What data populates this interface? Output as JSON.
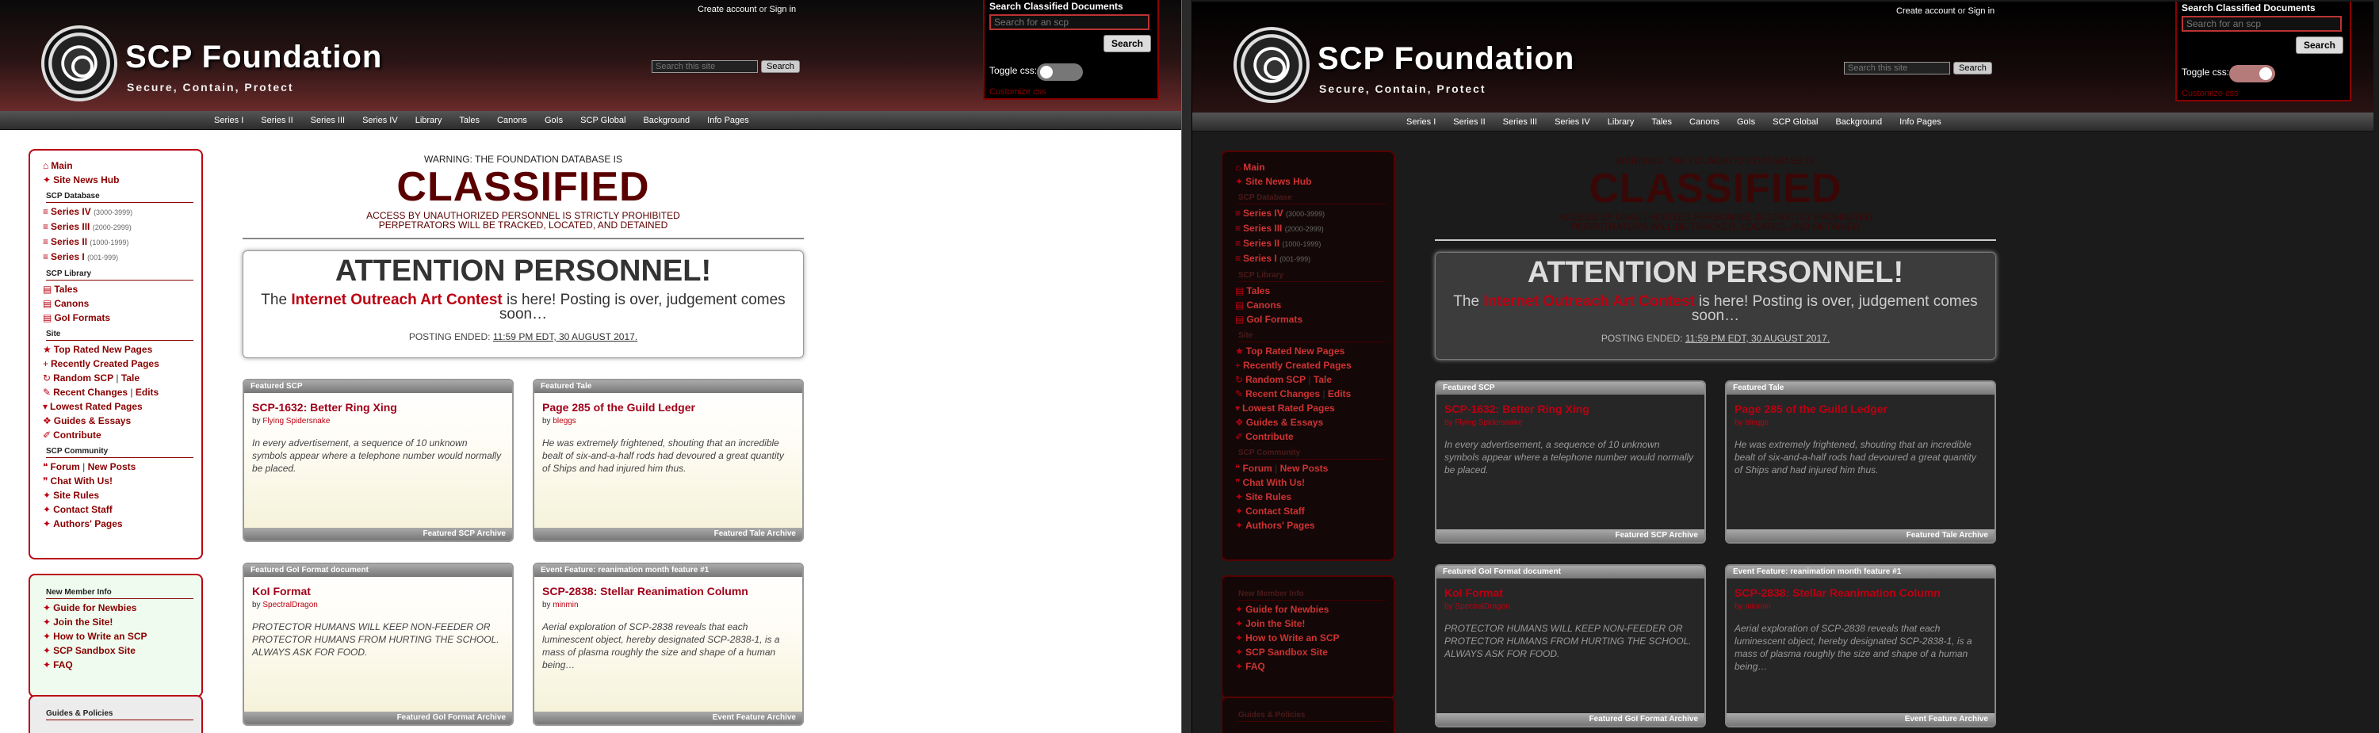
{
  "header": {
    "site_title": "SCP Foundation",
    "tagline": "Secure, Contain, Protect",
    "account_create": "Create account",
    "account_or": "or",
    "account_signin": "Sign in",
    "site_search_placeholder": "Search this site",
    "site_search_button": "Search"
  },
  "classified_search": {
    "title": "Search Classified Documents",
    "placeholder": "Search for an scp",
    "button": "Search",
    "toggle_label": "Toggle css:",
    "customize_link": "Customize css"
  },
  "toggle_states": {
    "left": "off",
    "right": "on"
  },
  "nav": [
    "Series I",
    "Series II",
    "Series III",
    "Series IV",
    "Library",
    "Tales",
    "Canons",
    "GoIs",
    "SCP Global",
    "Background",
    "Info Pages"
  ],
  "sidebar": {
    "main": "Main",
    "news": "Site News Hub",
    "db_head": "SCP Database",
    "series": [
      {
        "label": "Series IV",
        "range": "(3000-3999)"
      },
      {
        "label": "Series III",
        "range": "(2000-2999)"
      },
      {
        "label": "Series II",
        "range": "(1000-1999)"
      },
      {
        "label": "Series I",
        "range": "(001-999)"
      }
    ],
    "lib_head": "SCP Library",
    "library": [
      "Tales",
      "Canons",
      "GoI Formats"
    ],
    "site_head": "Site",
    "site": [
      "Top Rated New Pages",
      "Recently Created Pages",
      "Random SCP",
      "Tale",
      "Recent Changes",
      "Edits",
      "Lowest Rated Pages",
      "Guides & Essays",
      "Contribute"
    ],
    "comm_head": "SCP Community",
    "community": [
      "Forum",
      "New Posts",
      "Chat With Us!",
      "Site Rules",
      "Contact Staff",
      "Authors' Pages"
    ],
    "newmember_head": "New Member Info",
    "newmember": [
      "Guide for Newbies",
      "Join the Site!",
      "How to Write an SCP",
      "SCP Sandbox Site",
      "FAQ"
    ],
    "guides_head": "Guides & Policies"
  },
  "warning": {
    "top": "WARNING: THE FOUNDATION DATABASE IS",
    "big": "CLASSIFIED",
    "line1": "ACCESS BY UNAUTHORIZED PERSONNEL IS STRICTLY PROHIBITED",
    "line2": "PERPETRATORS WILL BE TRACKED, LOCATED, AND DETAINED"
  },
  "attention": {
    "title": "ATTENTION PERSONNEL!",
    "pre": "The",
    "link": "Internet Outreach Art Contest",
    "post": "is here! Posting is over, judgement comes soon…",
    "ended_label": "POSTING ENDED:",
    "ended_value": "11:59 PM EDT, 30 AUGUST 2017."
  },
  "cards": [
    {
      "header": "Featured SCP",
      "title": "SCP-1632: Better Ring Xing",
      "by": "by",
      "author": "Flying Spidersnake",
      "desc": "In every advertisement, a sequence of 10 unknown symbols appear where a telephone number would normally be placed.",
      "footer": "Featured SCP Archive"
    },
    {
      "header": "Featured Tale",
      "title": "Page 285 of the Guild Ledger",
      "by": "by",
      "author": "bleggs",
      "desc": "He was extremely frightened, shouting that an incredible bealt of six-and-a-half rods had devoured a great quantity of Ships and had injured him thus.",
      "footer": "Featured Tale Archive"
    },
    {
      "header": "Featured GoI Format document",
      "title": "KoI Format",
      "by": "by",
      "author": "SpectralDragon",
      "desc": "PROTECTOR HUMANS WILL KEEP NON-FEEDER OR PROTECTOR HUMANS FROM HURTING THE SCHOOL. ALWAYS ASK FOR FOOD.",
      "footer": "Featured GoI Format Archive"
    },
    {
      "header": "Event Feature: reanimation month feature #1",
      "title": "SCP-2838: Stellar Reanimation Column",
      "by": "by",
      "author": "minmin",
      "desc": "Aerial exploration of SCP-2838 reveals that each luminescent object, hereby designated SCP-2838-1, is a mass of plasma roughly the size and shape of a human being…",
      "footer": "Event Feature Archive"
    }
  ]
}
